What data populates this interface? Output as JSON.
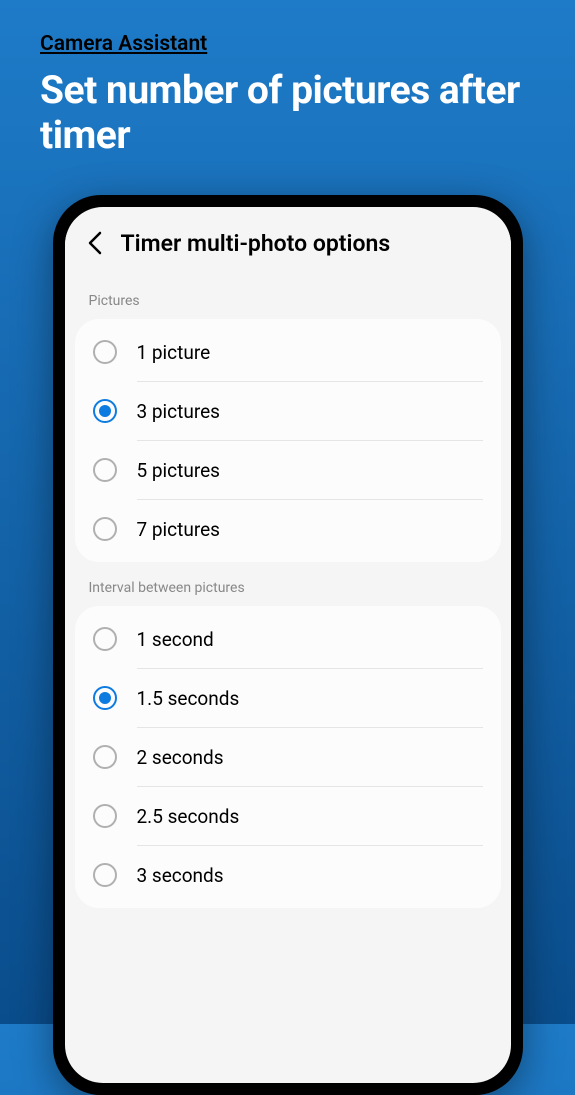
{
  "banner": {
    "subtitle": "Camera Assistant",
    "title": "Set number of pictures after timer"
  },
  "screen": {
    "title": "Timer multi-photo options"
  },
  "sections": {
    "pictures": {
      "label": "Pictures",
      "options": [
        {
          "label": "1 picture",
          "selected": false
        },
        {
          "label": "3 pictures",
          "selected": true
        },
        {
          "label": "5 pictures",
          "selected": false
        },
        {
          "label": "7 pictures",
          "selected": false
        }
      ]
    },
    "interval": {
      "label": "Interval between pictures",
      "options": [
        {
          "label": "1 second",
          "selected": false
        },
        {
          "label": "1.5 seconds",
          "selected": true
        },
        {
          "label": "2 seconds",
          "selected": false
        },
        {
          "label": "2.5 seconds",
          "selected": false
        },
        {
          "label": "3 seconds",
          "selected": false
        }
      ]
    }
  }
}
